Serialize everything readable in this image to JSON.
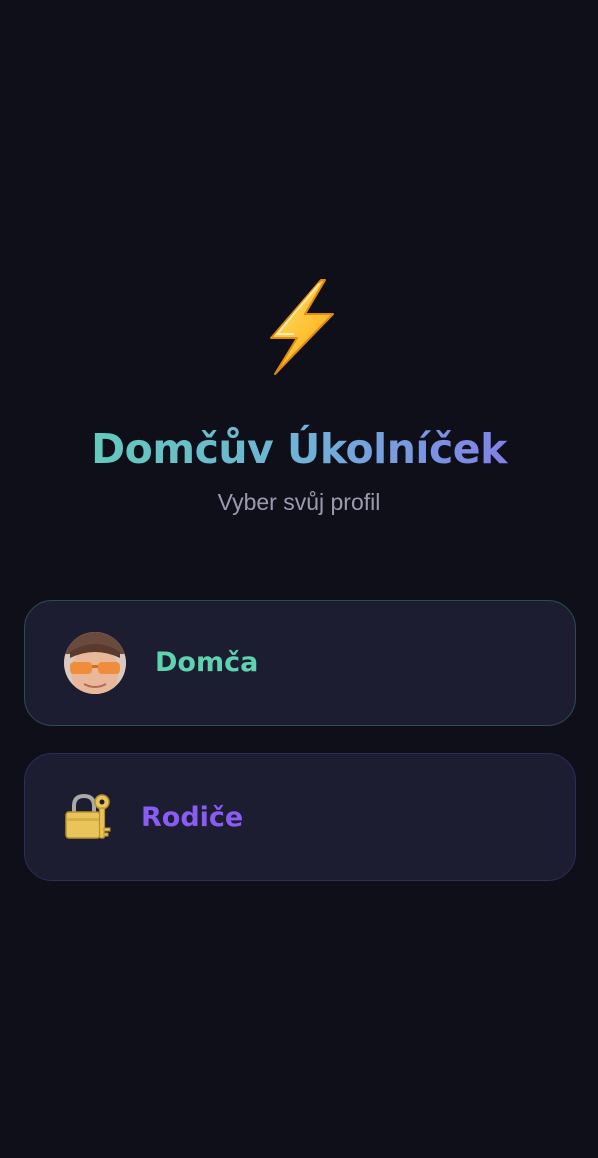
{
  "app": {
    "logo_icon": "lightning-bolt-icon",
    "title": "Domčův Úkolníček",
    "subtitle": "Vyber svůj profil",
    "title_gradient": [
      "#5ed3b0",
      "#8a6bf0"
    ],
    "background": "#0f0f1a"
  },
  "profiles": [
    {
      "name": "Domča",
      "icon": "avatar-photo",
      "color": "#5ed3b0"
    },
    {
      "name": "Rodiče",
      "icon": "locked-with-key-icon",
      "color": "#8a5cf6"
    }
  ]
}
